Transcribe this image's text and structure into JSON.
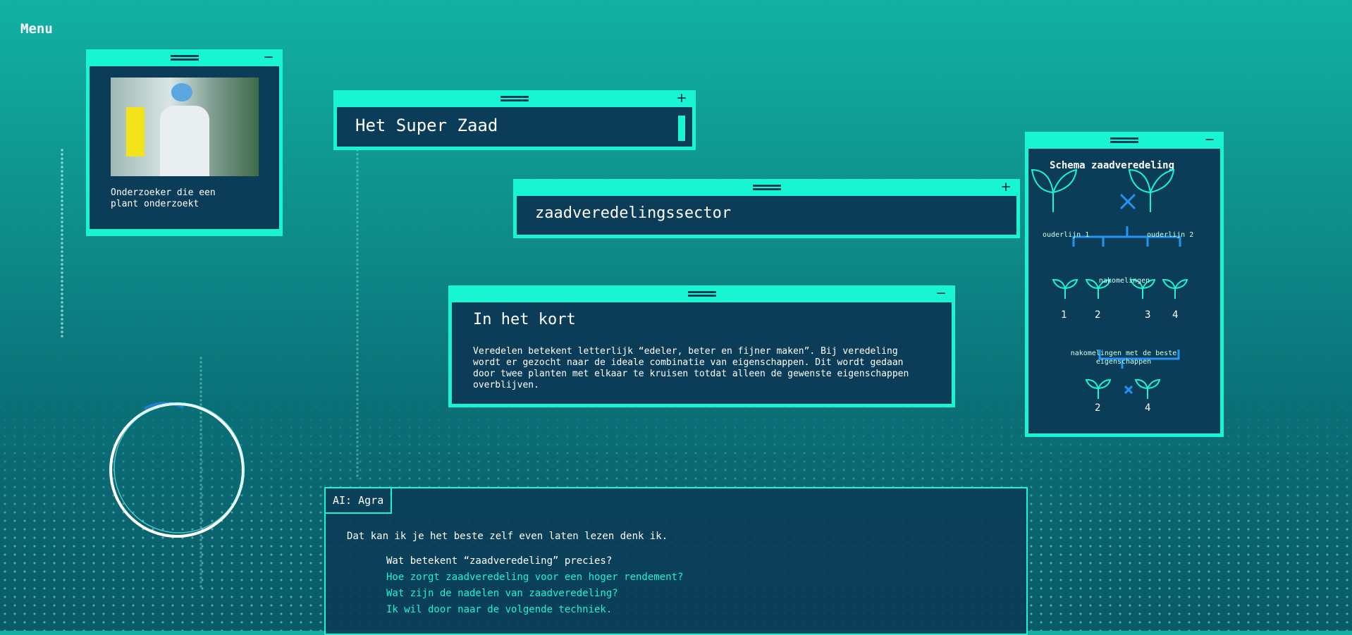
{
  "menu_label": "Menu",
  "photo_window": {
    "caption": "Onderzoeker die een plant onderzoekt"
  },
  "title_window": {
    "title": "Het Super Zaad"
  },
  "term_window": {
    "term": "zaadveredelingssector"
  },
  "summary_window": {
    "heading": "In het kort",
    "text": "Veredelen betekent letterlijk “edeler, beter en fijner maken”. Bij veredeling wordt er gezocht naar de ideale combinatie van eigenschappen. Dit wordt gedaan door twee planten met elkaar te kruisen totdat alleen de gewenste eigenschappen overblijven."
  },
  "schema_window": {
    "title": "Schema zaadveredeling",
    "parent1": "ouderlijn 1",
    "parent2": "ouderlijn 2",
    "offspring": "nakomelingen",
    "n1": "1",
    "n2": "2",
    "n3": "3",
    "n4": "4",
    "best": "nakomelingen met de beste eigenschappen",
    "b1": "2",
    "b2": "4"
  },
  "ai": {
    "name": "AI: Agra",
    "message": "Dat kan ik je het beste zelf even laten lezen denk ik.",
    "options": [
      "Wat betekent “zaadveredeling” precies?",
      "Hoe zorgt zaadveredeling voor een hoger rendement?",
      "Wat zijn de nadelen van zaadveredeling?",
      "Ik wil door naar de volgende techniek."
    ]
  },
  "colors": {
    "accent": "#17f5d2",
    "panel": "#0c3d58",
    "cross": "#2196f3"
  }
}
